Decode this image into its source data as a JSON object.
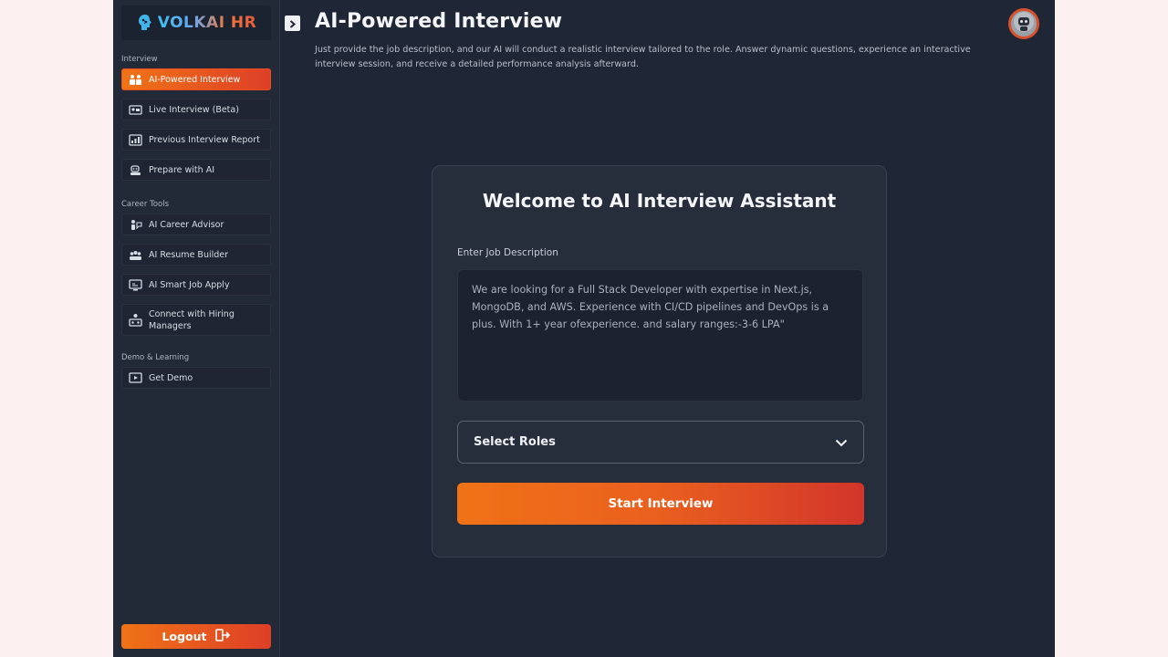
{
  "brand": {
    "name": "VOLKAI HR"
  },
  "sidebar": {
    "sections": {
      "interview": "Interview",
      "career": "Career Tools",
      "demo": "Demo & Learning"
    },
    "items": [
      {
        "label": "AI-Powered Interview",
        "icon": "interview-icon",
        "active": true
      },
      {
        "label": "Live Interview (Beta)",
        "icon": "live-video-icon"
      },
      {
        "label": "Previous Interview Report",
        "icon": "report-icon"
      },
      {
        "label": "Prepare with AI",
        "icon": "robot-study-icon"
      },
      {
        "label": "AI Career Advisor",
        "icon": "advisor-icon"
      },
      {
        "label": "AI Resume Builder",
        "icon": "resume-icon"
      },
      {
        "label": "AI Smart Job Apply",
        "icon": "job-apply-icon"
      },
      {
        "label": "Connect with Hiring Managers",
        "icon": "network-icon"
      },
      {
        "label": "Get Demo",
        "icon": "demo-icon"
      }
    ],
    "logout_label": "Logout"
  },
  "header": {
    "title": "AI-Powered Interview",
    "description": "Just provide the job description, and our AI will conduct a realistic interview tailored to the role. Answer dynamic questions, experience an interactive interview session, and receive a detailed performance analysis afterward."
  },
  "card": {
    "title": "Welcome to AI Interview Assistant",
    "jd_label": "Enter Job Description",
    "jd_value": "We are looking for a Full Stack Developer with expertise in Next.js, MongoDB, and AWS. Experience with CI/CD pipelines and DevOps is a plus. With 1+ year ofexperience. and salary ranges:-3-6 LPA\"",
    "roles_select": "Select Roles",
    "start_label": "Start Interview"
  },
  "colors": {
    "accent_start": "#f07316",
    "accent_end": "#de3f27",
    "background": "#1f2636"
  }
}
